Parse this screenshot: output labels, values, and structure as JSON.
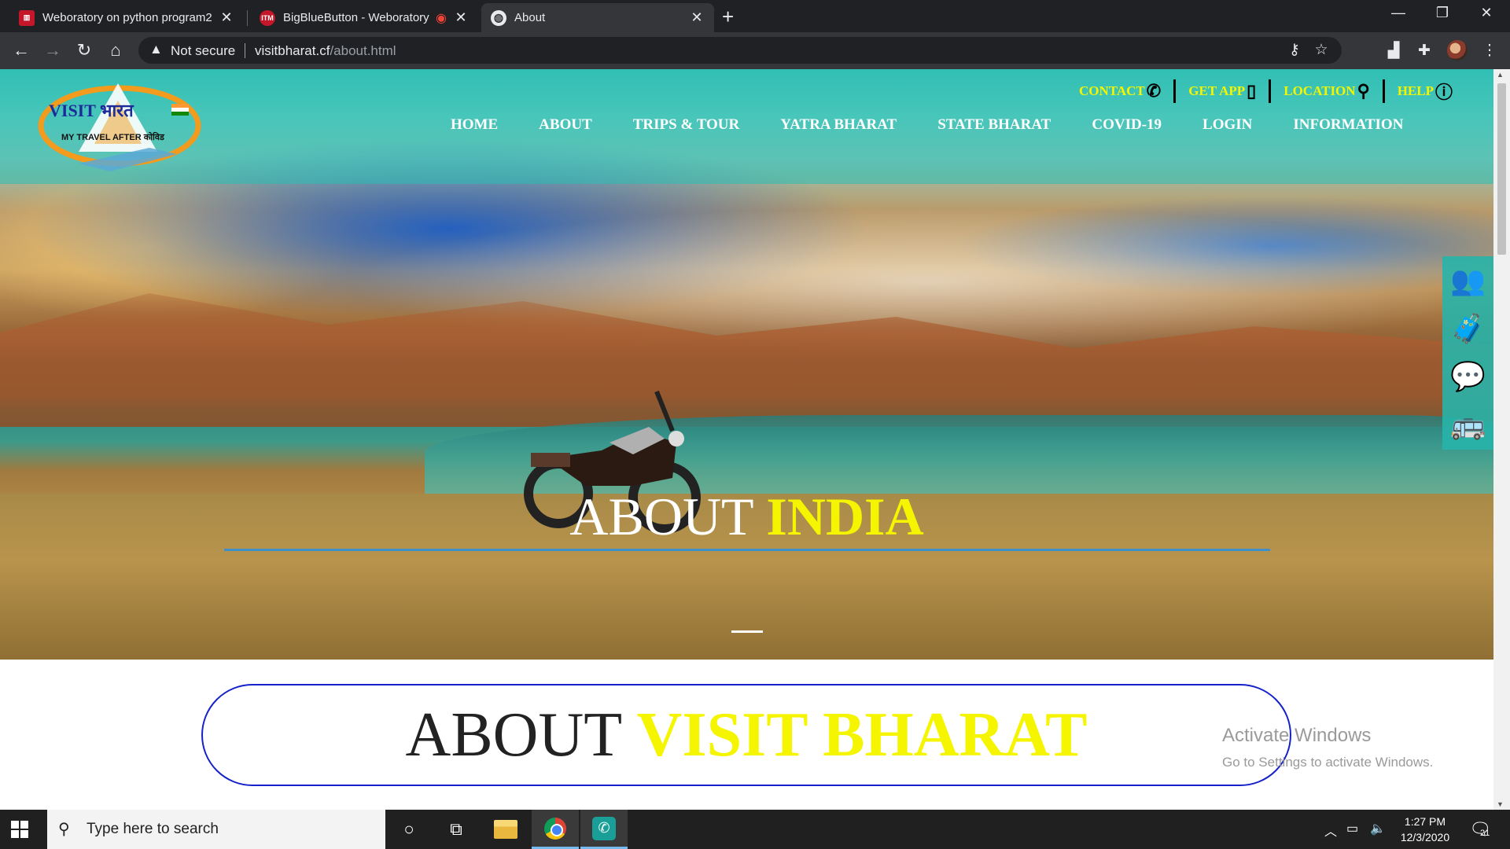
{
  "browser": {
    "tabs": [
      {
        "title": "Weboratory on python program2",
        "favicon": "weboratory-icon",
        "fav_color": "#c4182a",
        "active": false
      },
      {
        "title": "BigBlueButton - Weboratory",
        "favicon": "itm-live-icon",
        "fav_color": "#c4182a",
        "active": false,
        "recording": true
      },
      {
        "title": "About",
        "favicon": "globe-icon",
        "fav_color": "#35363a",
        "active": true
      }
    ],
    "new_tab_label": "+",
    "address": {
      "security_label": "Not secure",
      "domain": "visitbharat.cf",
      "path": "/about.html"
    }
  },
  "site": {
    "top_links": [
      {
        "label": "CONTACT",
        "icon": "phone-icon"
      },
      {
        "label": "GET APP",
        "icon": "mobile-icon"
      },
      {
        "label": "LOCATION",
        "icon": "map-pin-icon"
      },
      {
        "label": "HELP",
        "icon": "help-circle-icon"
      }
    ],
    "nav": [
      "HOME",
      "ABOUT",
      "TRIPS & TOUR",
      "YATRA BHARAT",
      "STATE BHARAT",
      "COVID-19",
      "LOGIN",
      "INFORMATION"
    ],
    "logo": {
      "line1": "VISIT भारत",
      "line2": "MY TRAVEL AFTER कोविड"
    },
    "hero": {
      "title_white": "ABOUT ",
      "title_yellow": "INDIA"
    },
    "side_icons": [
      "users-icon",
      "luggage-icon",
      "chat-icon",
      "bus-icon"
    ],
    "section": {
      "title_dark": "ABOUT ",
      "title_yellow": "VISIT BHARAT"
    },
    "colors": {
      "accent_yellow": "#f6f500",
      "pill_border": "#1522c9",
      "teal": "#28b4aa"
    }
  },
  "watermark": {
    "title": "Activate Windows",
    "subtitle": "Go to Settings to activate Windows."
  },
  "taskbar": {
    "search_placeholder": "Type here to search",
    "time": "1:27 PM",
    "date": "12/3/2020",
    "notification_count": "21"
  }
}
